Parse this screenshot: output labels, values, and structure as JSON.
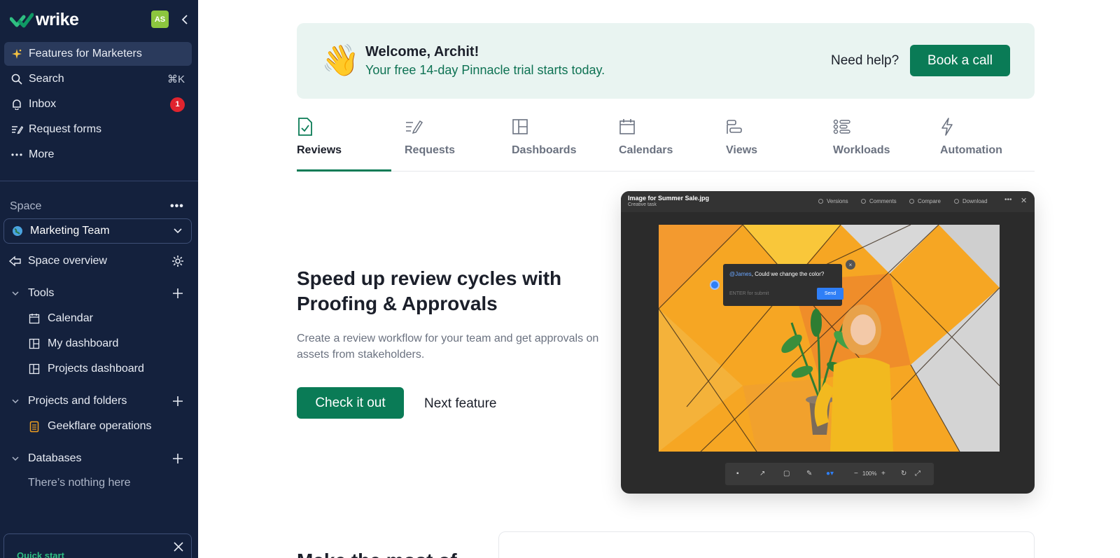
{
  "sidebar": {
    "logo_text": "wrike",
    "avatar_initials": "AS",
    "nav": [
      {
        "label": "Features for Marketers",
        "icon": "sparkle-icon"
      },
      {
        "label": "Search",
        "icon": "search-icon",
        "shortcut": "⌘K"
      },
      {
        "label": "Inbox",
        "icon": "bell-icon",
        "badge": "1"
      },
      {
        "label": "Request forms",
        "icon": "form-icon"
      },
      {
        "label": "More",
        "icon": "more-icon"
      }
    ],
    "space_label": "Space",
    "space_more": "•••",
    "space_select": "Marketing Team",
    "space_overview": "Space overview",
    "tools": {
      "label": "Tools",
      "items": [
        "Calendar",
        "My dashboard",
        "Projects dashboard"
      ]
    },
    "projects": {
      "label": "Projects and folders",
      "items": [
        "Geekflare operations"
      ]
    },
    "databases": {
      "label": "Databases",
      "empty": "There’s nothing here"
    },
    "quickstart_label": "Quick start"
  },
  "banner": {
    "emoji": "👋",
    "title": "Welcome, Archit!",
    "subtitle": "Your free 14-day Pinnacle trial starts today.",
    "help": "Need help?",
    "cta": "Book a call"
  },
  "tabs": [
    {
      "label": "Reviews",
      "icon": "review-check-icon",
      "active": true
    },
    {
      "label": "Requests",
      "icon": "pencil-form-icon"
    },
    {
      "label": "Dashboards",
      "icon": "dashboard-icon"
    },
    {
      "label": "Calendars",
      "icon": "calendar-icon"
    },
    {
      "label": "Views",
      "icon": "views-icon"
    },
    {
      "label": "Workloads",
      "icon": "workload-icon"
    },
    {
      "label": "Automation",
      "icon": "lightning-icon"
    }
  ],
  "feature": {
    "title": "Speed up review cycles with Proofing & Approvals",
    "description": "Create a review workflow for your team and get approvals on assets from stakeholders.",
    "primary": "Check it out",
    "secondary": "Next feature"
  },
  "preview": {
    "file_title": "Image for Summer Sale.jpg",
    "file_sub": "Creative task",
    "actions": [
      "Versions",
      "Comments",
      "Compare",
      "Download"
    ],
    "comment_mention": "@James",
    "comment_text": ", Could we change the color?",
    "comment_placeholder": "ENTER for submit",
    "comment_send": "Send",
    "zoom": "100%"
  },
  "bottom_heading": "Make the most of",
  "colors": {
    "sidebar": "#14213d",
    "brand_green": "#0a7b56",
    "banner_bg": "#e9f4f1"
  }
}
